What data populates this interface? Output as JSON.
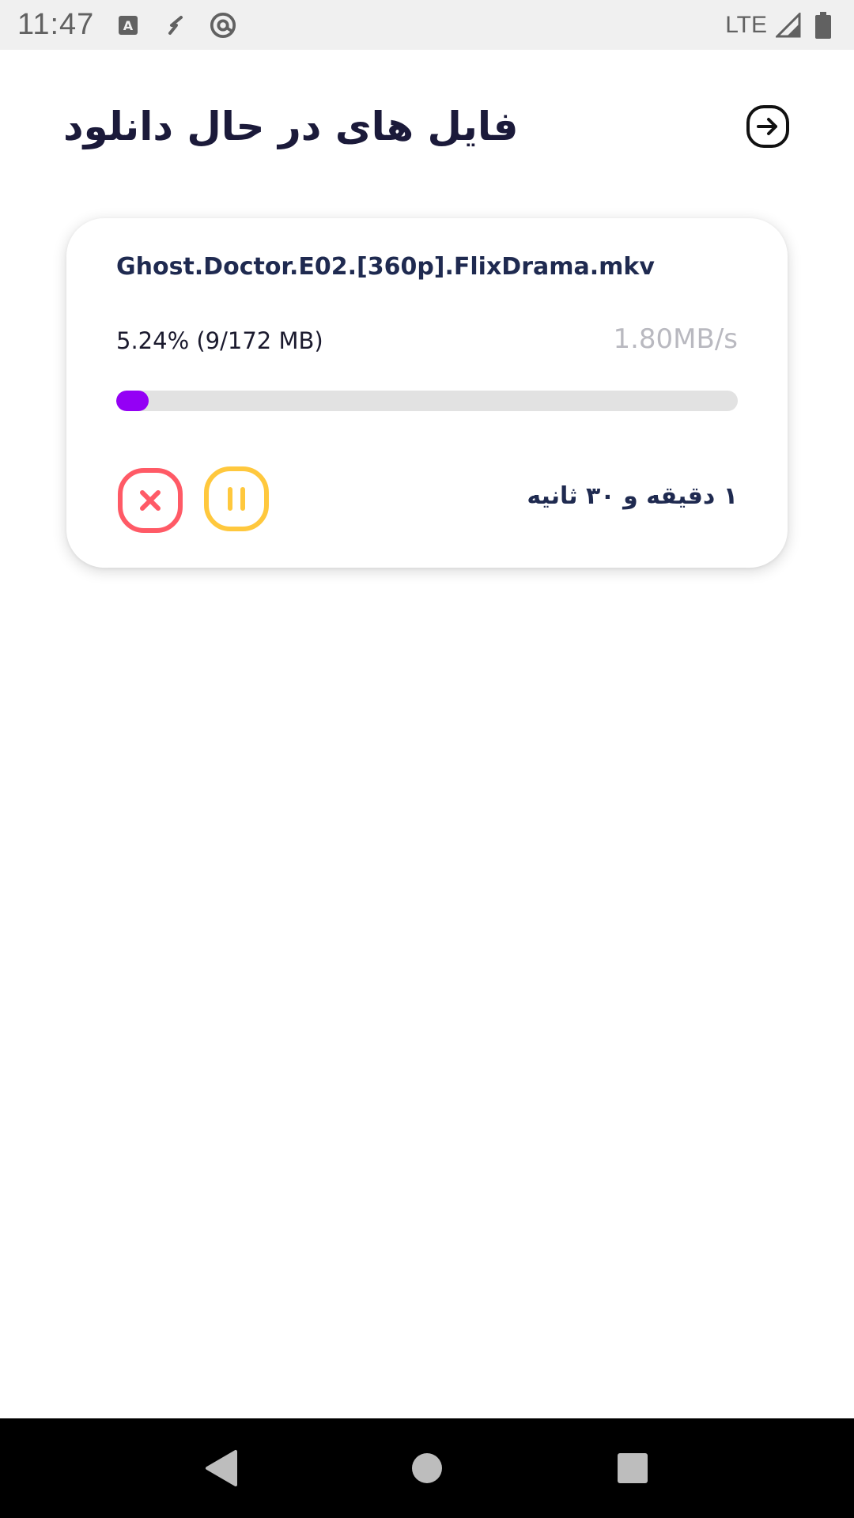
{
  "status_bar": {
    "time": "11:47",
    "network": "LTE",
    "icons": [
      "keyboard-a-icon",
      "phone-forward-icon",
      "at-sign-icon",
      "signal-icon",
      "battery-icon"
    ]
  },
  "header": {
    "title": "فایل های در حال دانلود",
    "back_icon": "arrow-right-circle-icon"
  },
  "download": {
    "file_name": "Ghost.Doctor.E02.[360p].FlixDrama.mkv",
    "progress_label": "5.24% (9/172 MB)",
    "progress_fraction": 0.0524,
    "speed": "1.80MB/s",
    "remaining_time": "۱ دقیقه و ۳۰ ثانیه",
    "cancel_icon": "close-square-icon",
    "pause_icon": "pause-square-icon"
  },
  "colors": {
    "title": "#1b1a3a",
    "accent_progress": "#9400f5",
    "cancel": "#ff5a66",
    "pause": "#ffc83d",
    "speed_text": "#b9b9c0"
  },
  "nav_bar": {
    "icons": [
      "back-triangle-icon",
      "home-circle-icon",
      "recents-square-icon"
    ]
  }
}
